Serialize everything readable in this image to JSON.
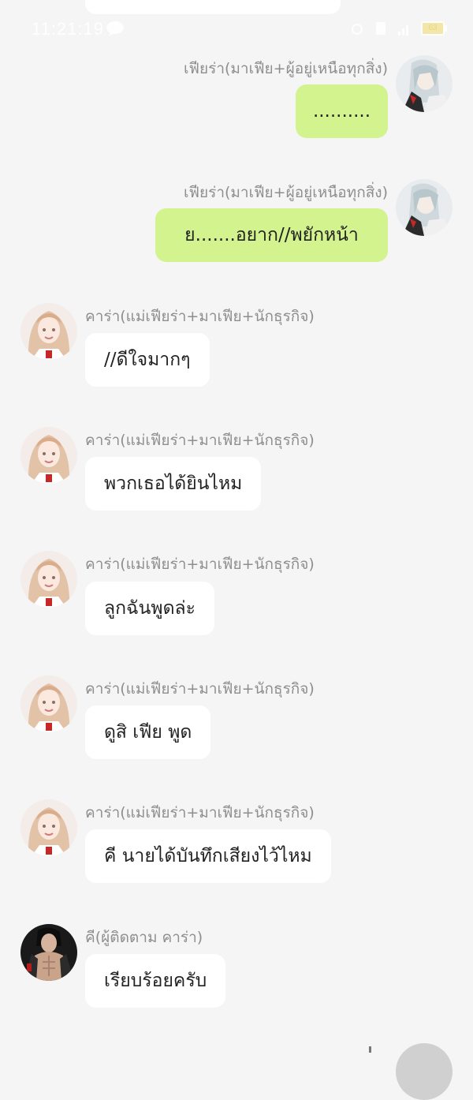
{
  "status_bar": {
    "time": "11:21:19",
    "battery": "63"
  },
  "messages": [
    {
      "sender": "เฟียร่า(มาเฟีย+ผู้อยู่เหนือทุกสิ่ง)",
      "text": "..........",
      "direction": "outgoing"
    },
    {
      "sender": "เฟียร่า(มาเฟีย+ผู้อยู่เหนือทุกสิ่ง)",
      "text": "ย.......อยาก//พยักหน้า",
      "direction": "outgoing"
    },
    {
      "sender": "คาร่า(แม่เฟียร่า+มาเฟีย+นักธุรกิจ)",
      "text": "//ดีใจมากๆ",
      "direction": "incoming"
    },
    {
      "sender": "คาร่า(แม่เฟียร่า+มาเฟีย+นักธุรกิจ)",
      "text": "พวกเธอได้ยินไหม",
      "direction": "incoming"
    },
    {
      "sender": "คาร่า(แม่เฟียร่า+มาเฟีย+นักธุรกิจ)",
      "text": "ลูกฉันพูดล่ะ",
      "direction": "incoming"
    },
    {
      "sender": "คาร่า(แม่เฟียร่า+มาเฟีย+นักธุรกิจ)",
      "text": "ดูสิ เฟีย พูด",
      "direction": "incoming"
    },
    {
      "sender": "คาร่า(แม่เฟียร่า+มาเฟีย+นักธุรกิจ)",
      "text": "คี นายได้บันทึกเสียงไว้ไหม",
      "direction": "incoming"
    },
    {
      "sender": "คี(ผู้ติดตาม คาร่า)",
      "text": "เรียบร้อยครับ",
      "direction": "incoming"
    }
  ],
  "colors": {
    "background": "#f5f5f5",
    "outgoing_bubble": "#d3f38e",
    "incoming_bubble": "#ffffff",
    "sender_text": "#8e8e8e"
  },
  "avatars": {
    "fiara": "silver-haired-character-avatar",
    "kara": "blonde-woman-avatar",
    "kee": "dark-haired-man-avatar"
  }
}
